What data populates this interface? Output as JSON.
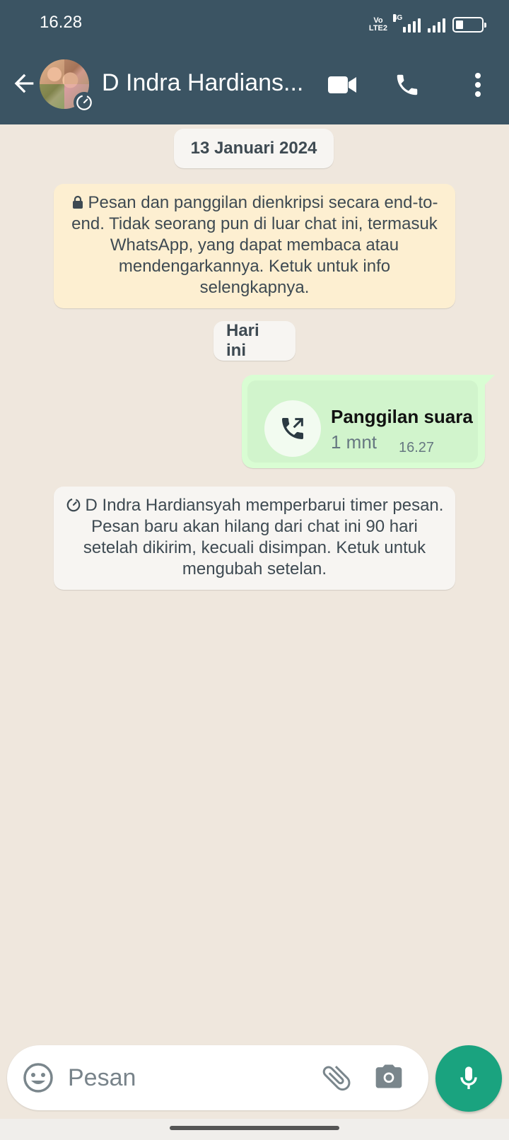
{
  "status_bar": {
    "time": "16.28",
    "volte_label": "Vo LTE2",
    "net_label": "4G"
  },
  "header": {
    "contact_name": "D Indra Hardians...",
    "icons": [
      "back-arrow-icon",
      "video-camera-icon",
      "phone-icon",
      "more-vert-icon"
    ]
  },
  "chat": {
    "date_chip": "13 Januari 2024",
    "encryption_notice": "Pesan dan panggilan dienkripsi secara end-to-end. Tidak seorang pun di luar chat ini, termasuk WhatsApp, yang dapat membaca atau mendengarkannya. Ketuk untuk info selengkapnya.",
    "today_chip": "Hari ini",
    "call_message": {
      "title": "Panggilan suara",
      "duration": "1 mnt",
      "time": "16.27"
    },
    "system_message": "D Indra Hardiansyah memperbarui timer pesan. Pesan baru akan hilang dari chat ini 90 hari setelah dikirim, kecuali disimpan. Ketuk untuk mengubah setelan."
  },
  "input_bar": {
    "placeholder": "Pesan"
  },
  "colors": {
    "header": "#3b5463",
    "chat_bg": "#efe7dd",
    "outgoing_bubble": "#d9fdd3",
    "encryption_bg": "#fdefd1",
    "accent": "#1aa37f"
  }
}
